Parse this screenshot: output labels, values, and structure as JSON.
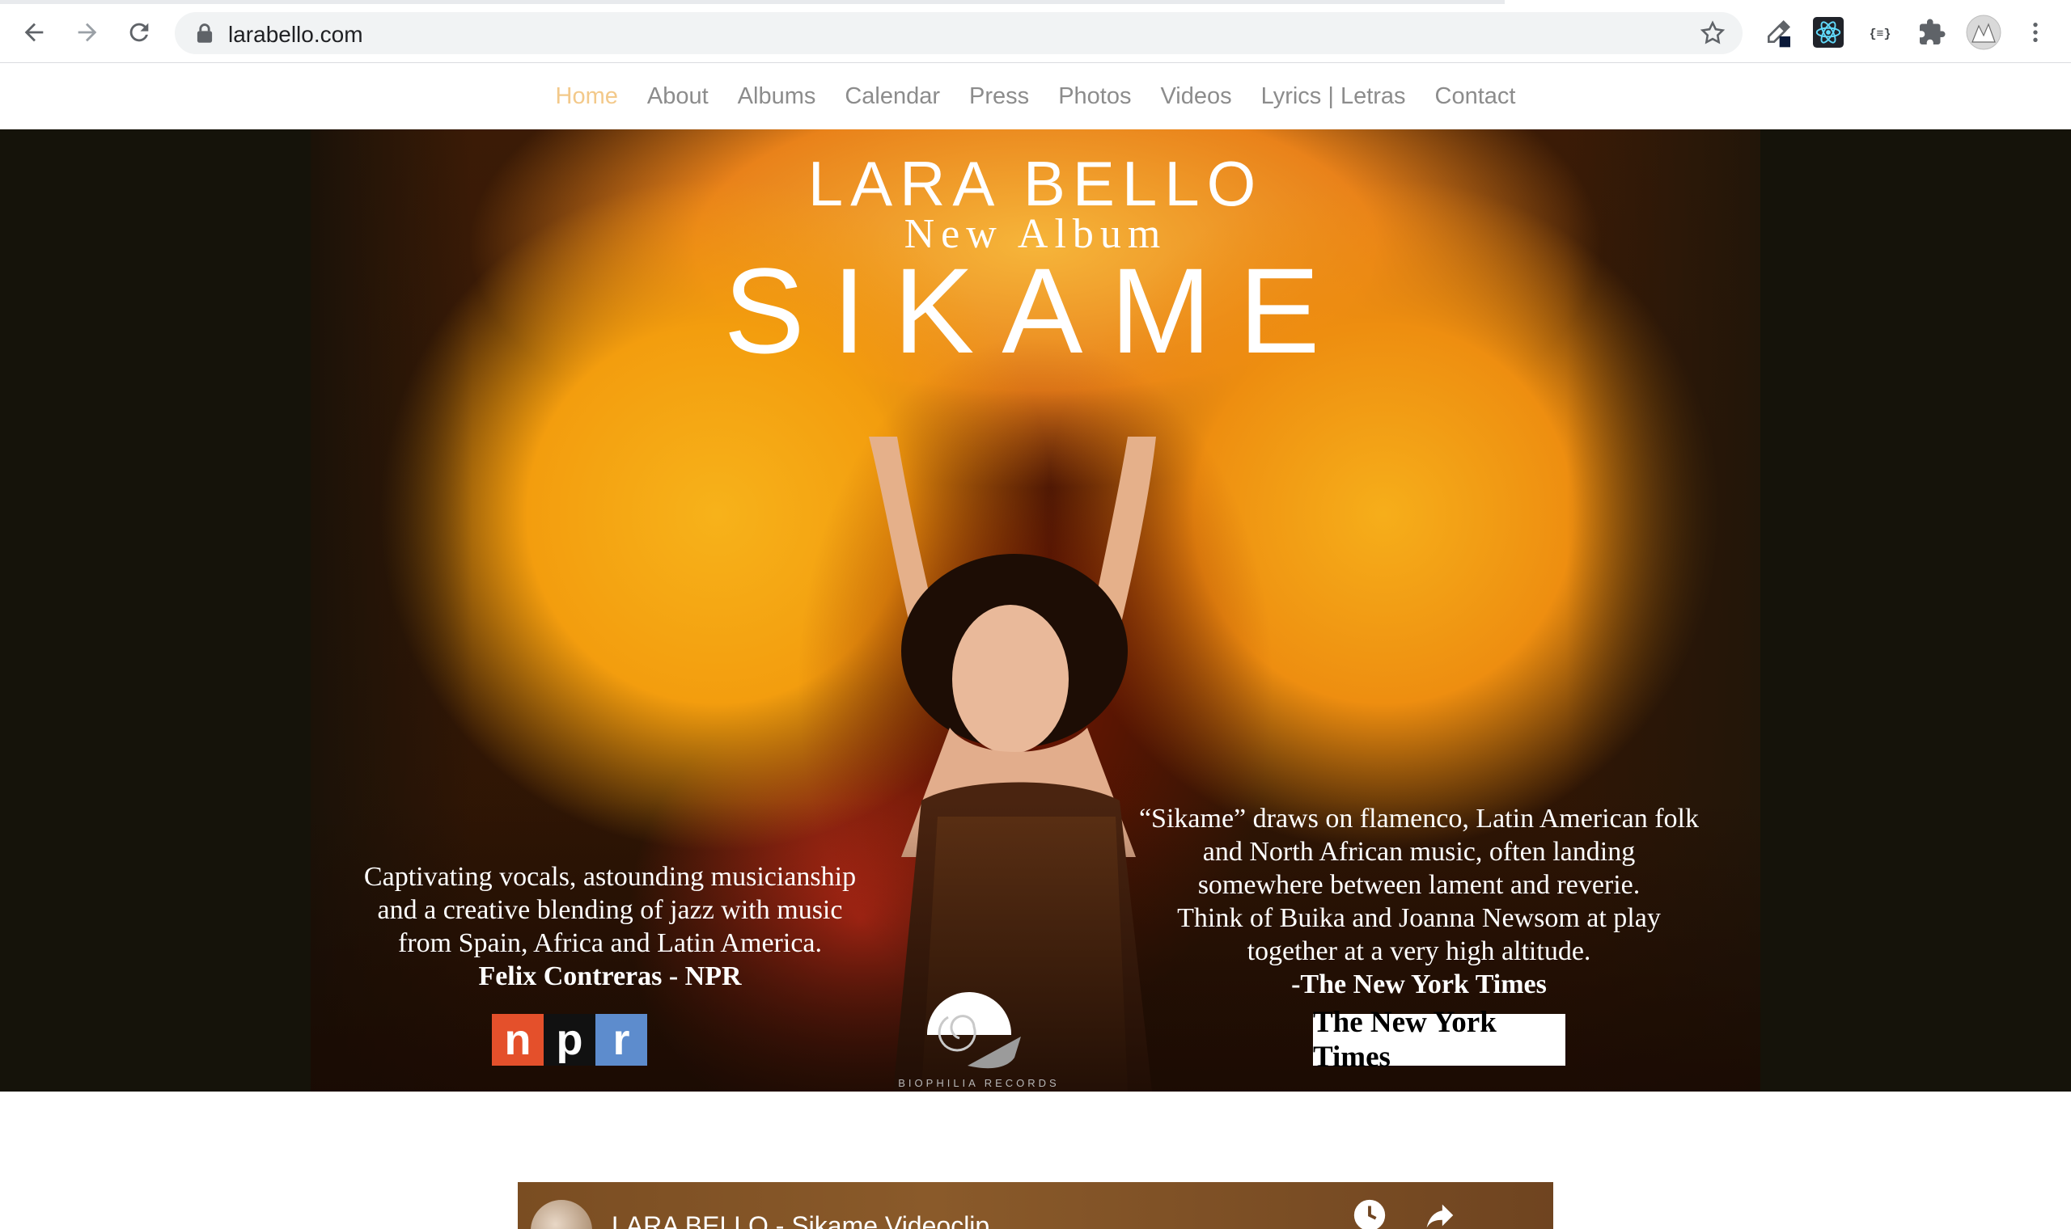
{
  "browser": {
    "url": "larabello.com"
  },
  "nav": {
    "items": [
      {
        "label": "Home",
        "active": true
      },
      {
        "label": "About"
      },
      {
        "label": "Albums"
      },
      {
        "label": "Calendar"
      },
      {
        "label": "Press"
      },
      {
        "label": "Photos"
      },
      {
        "label": "Videos"
      },
      {
        "label": "Lyrics | Letras"
      },
      {
        "label": "Contact"
      }
    ],
    "active_color": "#f3c98a",
    "text_color": "#8c8c8c"
  },
  "hero": {
    "title": "LARA BELLO",
    "subtitle": "New Album",
    "album": "SIKAME",
    "quote_left": {
      "lines": [
        "Captivating vocals, astounding musicianship",
        "and a creative blending of jazz with music",
        "from Spain, Africa and Latin America."
      ],
      "attribution": "Felix Contreras - NPR",
      "logo": [
        "n",
        "p",
        "r"
      ]
    },
    "quote_right": {
      "lines": [
        "“Sikame” draws on flamenco, Latin American folk",
        "and North African music, often landing",
        "somewhere between lament and reverie.",
        "Think of Buika and Joanna Newsom at play",
        "together at a very high altitude."
      ],
      "attribution": "-The New York Times",
      "logo": "The New York Times"
    },
    "label": "BIOPHILIA RECORDS"
  },
  "video": {
    "title": "LARA BELLO - Sikame Videoclip"
  },
  "icons": {
    "back": "back-arrow-icon",
    "forward": "forward-arrow-icon",
    "reload": "reload-icon",
    "lock": "lock-icon",
    "star": "star-icon",
    "extensions": [
      "eyedropper-extension-icon",
      "react-devtools-icon",
      "json-formatter-icon",
      "puzzle-extensions-icon",
      "profile-avatar-icon",
      "kebab-menu-icon"
    ]
  }
}
